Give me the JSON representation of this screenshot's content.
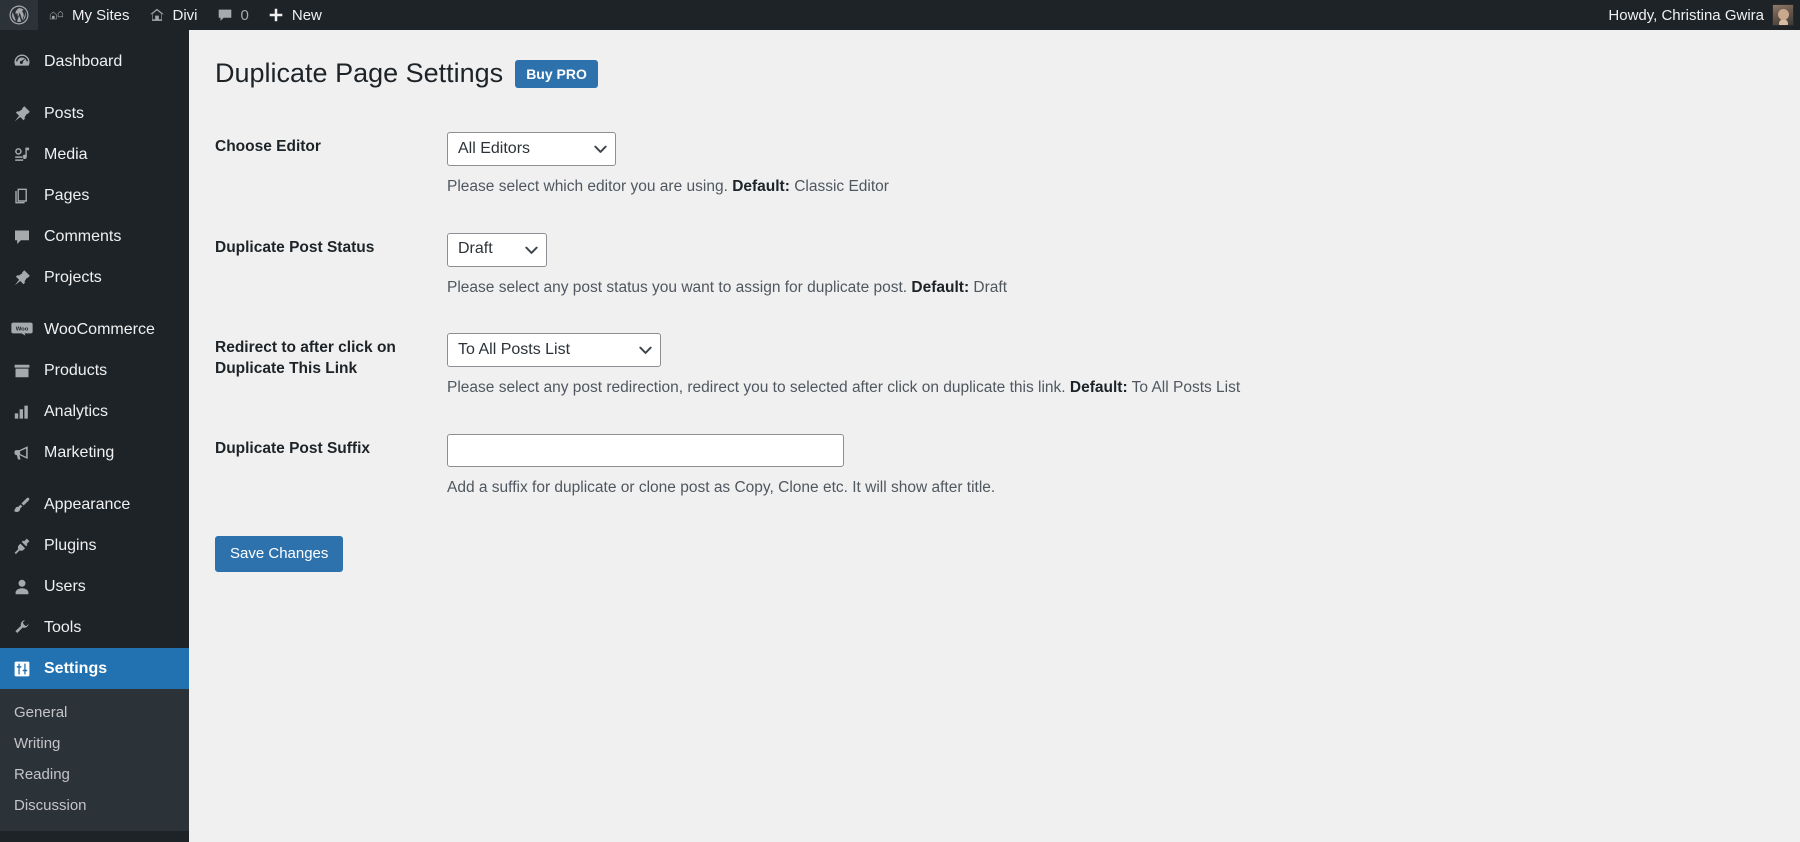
{
  "adminbar": {
    "items": [
      {
        "icon": "wordpress-logo-icon",
        "label": ""
      },
      {
        "icon": "my-sites-icon",
        "label": "My Sites"
      },
      {
        "icon": "home-icon",
        "label": "Divi"
      },
      {
        "icon": "comment-bubble-icon",
        "label": "0"
      },
      {
        "icon": "plus-icon",
        "label": "New"
      }
    ],
    "my_sites_label": "My Sites",
    "site_label": "Divi",
    "comment_count": "0",
    "new_label": "New",
    "howdy": "Howdy, Christina Gwira"
  },
  "sidebar": {
    "items": [
      {
        "label": "Dashboard",
        "icon": "dashboard-icon",
        "current": false
      },
      {
        "label": "Posts",
        "icon": "pin-icon",
        "current": false
      },
      {
        "label": "Media",
        "icon": "media-icon",
        "current": false
      },
      {
        "label": "Pages",
        "icon": "pages-icon",
        "current": false
      },
      {
        "label": "Comments",
        "icon": "comment-bubble-icon",
        "current": false
      },
      {
        "label": "Projects",
        "icon": "pin-icon",
        "current": false
      },
      {
        "label": "WooCommerce",
        "icon": "woocommerce-icon",
        "current": false
      },
      {
        "label": "Products",
        "icon": "products-box-icon",
        "current": false
      },
      {
        "label": "Analytics",
        "icon": "bar-chart-icon",
        "current": false
      },
      {
        "label": "Marketing",
        "icon": "megaphone-icon",
        "current": false
      },
      {
        "label": "Appearance",
        "icon": "paintbrush-icon",
        "current": false
      },
      {
        "label": "Plugins",
        "icon": "plug-icon",
        "current": false
      },
      {
        "label": "Users",
        "icon": "user-icon",
        "current": false
      },
      {
        "label": "Tools",
        "icon": "wrench-icon",
        "current": false
      },
      {
        "label": "Settings",
        "icon": "settings-sliders-icon",
        "current": true
      }
    ],
    "submenu": [
      {
        "label": "General"
      },
      {
        "label": "Writing"
      },
      {
        "label": "Reading"
      },
      {
        "label": "Discussion"
      }
    ],
    "active_item": "Settings",
    "accent_color": "#2271b1",
    "background_color": "#1d2327"
  },
  "page": {
    "title": "Duplicate Page Settings",
    "buy_pro_label": "Buy PRO",
    "buy_pro_color": "#2e72ad"
  },
  "form": {
    "rows": [
      {
        "label": "Choose Editor",
        "control": "select",
        "value": "All Editors",
        "description_pre": "Please select which editor you are using. ",
        "description_strong": "Default:",
        "description_post": " Classic Editor"
      },
      {
        "label": "Duplicate Post Status",
        "control": "select",
        "value": "Draft",
        "description_pre": "Please select any post status you want to assign for duplicate post. ",
        "description_strong": "Default:",
        "description_post": " Draft"
      },
      {
        "label": "Redirect to after click on Duplicate This Link",
        "control": "select",
        "value": "To All Posts List",
        "description_pre": "Please select any post redirection, redirect you to selected after click on duplicate this link. ",
        "description_strong": "Default:",
        "description_post": " To All Posts List"
      },
      {
        "label": "Duplicate Post Suffix",
        "control": "text",
        "value": "",
        "placeholder": "",
        "description_pre": "Add a suffix for duplicate or clone post as Copy, Clone etc. It will show after title.",
        "description_strong": "",
        "description_post": ""
      }
    ],
    "save_label": "Save Changes"
  }
}
